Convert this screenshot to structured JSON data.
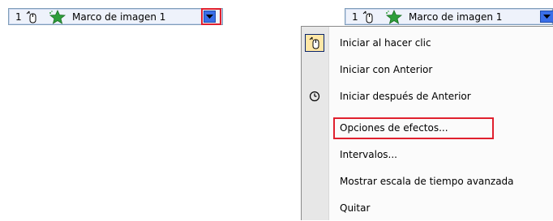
{
  "left_bar": {
    "number": "1",
    "effect_label": "Marco de imagen 1"
  },
  "right_bar": {
    "number": "1",
    "effect_label": "Marco de imagen 1"
  },
  "menu": {
    "items": [
      {
        "label": "Iniciar al hacer clic",
        "icon": "mouse-click-icon"
      },
      {
        "label": "Iniciar con Anterior",
        "icon": ""
      },
      {
        "label": "Iniciar después de Anterior",
        "icon": "clock-icon"
      },
      {
        "label": "Opciones de efectos...",
        "icon": ""
      },
      {
        "label": "Intervalos...",
        "icon": ""
      },
      {
        "label": "Mostrar escala de tiempo avanzada",
        "icon": ""
      },
      {
        "label": "Quitar",
        "icon": ""
      }
    ]
  },
  "colors": {
    "highlight": "#e0202e",
    "dropdown": "#3a6ee8",
    "bar_bg": "#eef2fb",
    "checked_icon_bg": "#ffe7a6"
  }
}
